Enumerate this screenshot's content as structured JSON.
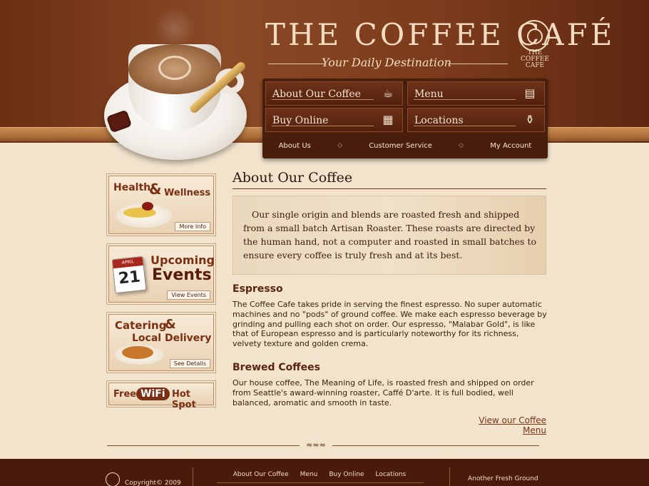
{
  "logo": {
    "title": "THE COFFEE CAFÉ",
    "tagline": "Your Daily Destination",
    "badge_text": "THE COFFEE CAFE"
  },
  "nav": {
    "buttons": [
      {
        "label": "About Our Coffee",
        "icon": "coffee-cup-icon"
      },
      {
        "label": "Menu",
        "icon": "menu-book-icon"
      },
      {
        "label": "Buy Online",
        "icon": "basket-icon"
      },
      {
        "label": "Locations",
        "icon": "teapot-icon"
      }
    ],
    "subnav": [
      "About Us",
      "Customer Service",
      "My Account"
    ]
  },
  "sidebar": {
    "health": {
      "title_a": "Health",
      "amp": "&",
      "title_b": "Wellness",
      "button": "More Info"
    },
    "events": {
      "cal_month": "APRIL",
      "cal_day": "21",
      "title_a": "Upcoming",
      "title_b": "Events",
      "button": "View Events"
    },
    "catering": {
      "title_a": "Catering",
      "amp": "&",
      "title_b": "Local Delivery",
      "button": "See Details"
    },
    "wifi": {
      "free": "Free",
      "wifi": "WiFi",
      "hotspot": "Hot Spot"
    }
  },
  "main": {
    "title": "About Our Coffee",
    "intro": "Our single origin and blends are roasted fresh and shipped from a small batch Artisan Roaster. These roasts are directed by the human hand, not a computer and roasted in small batches to ensure every coffee is truly fresh and at its best.",
    "espresso": {
      "heading": "Espresso",
      "body": "The Coffee Cafe takes pride in serving the finest espresso. No super automatic machines and no \"pods\" of ground coffee. We make each espresso beverage by grinding and pulling each shot on order. Our espresso, \"Malabar Gold\", is like that of European espresso and is particularly noteworthy for its richness, velvety texture and golden crema."
    },
    "brewed": {
      "heading": "Brewed Coffees",
      "body": "Our house coffee, The Meaning of Life, is roasted fresh and shipped on order from Seattle's award-winning roaster, Caffé D'arte. It is full bodied, well balanced, aromatic and smooth in taste."
    },
    "menu_link": "View our Coffee Menu"
  },
  "footer": {
    "copyright": "Copyright© 2009",
    "nav": [
      "About Our Coffee",
      "Menu",
      "Buy Online",
      "Locations"
    ],
    "right_text": "Another Fresh Ground"
  },
  "colors": {
    "header_brown": "#6b2e12",
    "cream_background": "#f1e3cc",
    "accent_rust": "#7a2f12"
  }
}
